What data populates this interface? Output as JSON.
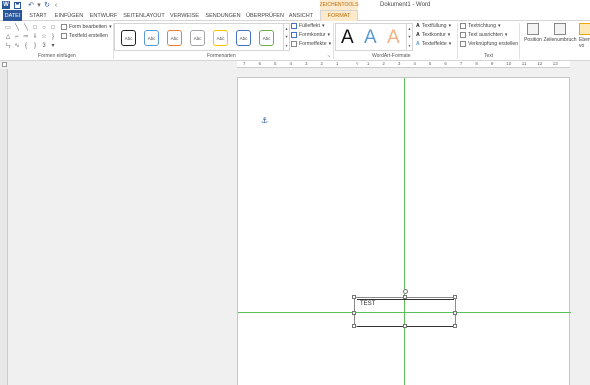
{
  "app": {
    "logo": "W",
    "title": "Dokument1 - Word"
  },
  "qat": {
    "save_icon": "save-icon",
    "undo_icon": "undo-icon",
    "redo_icon": "redo-icon",
    "more_icon": "customize-icon"
  },
  "contextual_header": "ZEICHENTOOLS",
  "tabs": [
    {
      "label": "DATEI"
    },
    {
      "label": "START"
    },
    {
      "label": "EINFÜGEN"
    },
    {
      "label": "ENTWURF"
    },
    {
      "label": "SEITENLAYOUT"
    },
    {
      "label": "VERWEISE"
    },
    {
      "label": "SENDUNGEN"
    },
    {
      "label": "ÜBERPRÜFEN"
    },
    {
      "label": "ANSICHT"
    },
    {
      "label": "FORMAT"
    }
  ],
  "ribbon": {
    "insert_shapes": {
      "label": "Formen einfügen",
      "edit_shape": "Form bearbeiten",
      "draw_textbox": "Textfeld erstellen"
    },
    "shape_styles": {
      "label": "Formenarten",
      "style_sample": "Abc",
      "fill": "Fülleffekt",
      "outline": "Formkontur",
      "effects": "Formeffekte"
    },
    "wordart_styles": {
      "label": "WordArt-Formate",
      "sample": "A",
      "text_fill": "Textfüllung",
      "text_outline": "Textkontur",
      "text_effects": "Texteffekte"
    },
    "text": {
      "label": "Text",
      "direction": "Textrichtung",
      "align": "Text ausrichten",
      "link": "Verknüpfung erstellen"
    },
    "arrange": {
      "position": "Position",
      "wrap": "Zeilenumbruch",
      "forward": "Eben vo"
    }
  },
  "ruler": {
    "numbers": [
      "7",
      "6",
      "5",
      "4",
      "3",
      "2",
      "1",
      "",
      "1",
      "2",
      "3",
      "4",
      "5",
      "6",
      "7",
      "8",
      "9",
      "10",
      "11",
      "12",
      "13"
    ]
  },
  "document": {
    "textbox_text": "TEST"
  },
  "colors": {
    "word_blue": "#2b579a",
    "context_orange": "#b96b00",
    "guide_green": "#5cbf5c"
  }
}
